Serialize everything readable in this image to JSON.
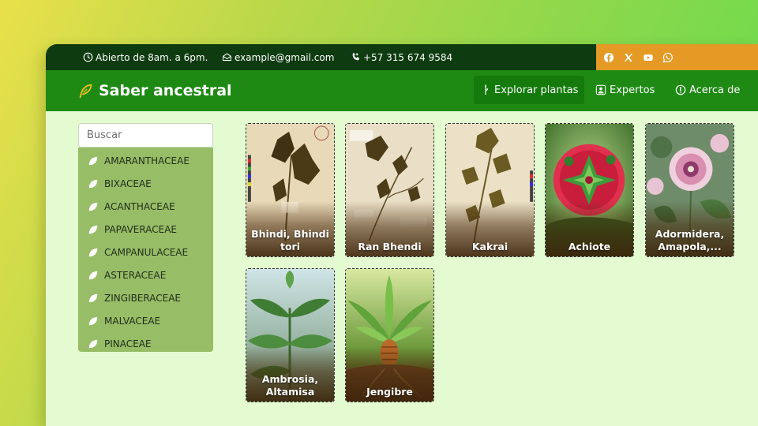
{
  "topbar": {
    "hours": "Abierto de 8am. a 6pm.",
    "email": "example@gmail.com",
    "phone": "+57 315 674 9584",
    "social_icons": [
      "facebook-icon",
      "x-icon",
      "youtube-icon",
      "whatsapp-icon"
    ]
  },
  "navbar": {
    "brand": "Saber ancestral",
    "items": [
      {
        "label": "Explorar plantas",
        "icon": "plant-icon",
        "active": true
      },
      {
        "label": "Expertos",
        "icon": "users-icon",
        "active": false
      },
      {
        "label": "Acerca de",
        "icon": "info-icon",
        "active": false
      }
    ]
  },
  "sidebar": {
    "search_placeholder": "Buscar",
    "families": [
      "AMARANTHACEAE",
      "BIXACEAE",
      "ACANTHACEAE",
      "PAPAVERACEAE",
      "CAMPANULACEAE",
      "ASTERACEAE",
      "ZINGIBERACEAE",
      "MALVACEAE",
      "PINACEAE"
    ]
  },
  "plants": [
    {
      "name": "Bhindi, Bhindi tori",
      "image": "herbarium-specimen"
    },
    {
      "name": "Ran Bhendi",
      "image": "herbarium-specimen"
    },
    {
      "name": "Kakrai",
      "image": "herbarium-specimen"
    },
    {
      "name": "Achiote",
      "image": "achiote-fruit"
    },
    {
      "name": "Adormidera, Amapola,...",
      "image": "poppy-flowers"
    },
    {
      "name": "Ambrosia, Altamisa",
      "image": "ambrosia-leaves"
    },
    {
      "name": "Jengibre",
      "image": "ginger-plant"
    }
  ],
  "colors": {
    "background_gradient_start": "#e9e04a",
    "background_gradient_end": "#5fdc4e",
    "topbar": "#0e3b0f",
    "social_bar": "#e49a24",
    "navbar": "#1e8a14",
    "nav_active": "#137a0b",
    "page": "#e4fbd2",
    "sidebar_list": "#97bd67"
  }
}
